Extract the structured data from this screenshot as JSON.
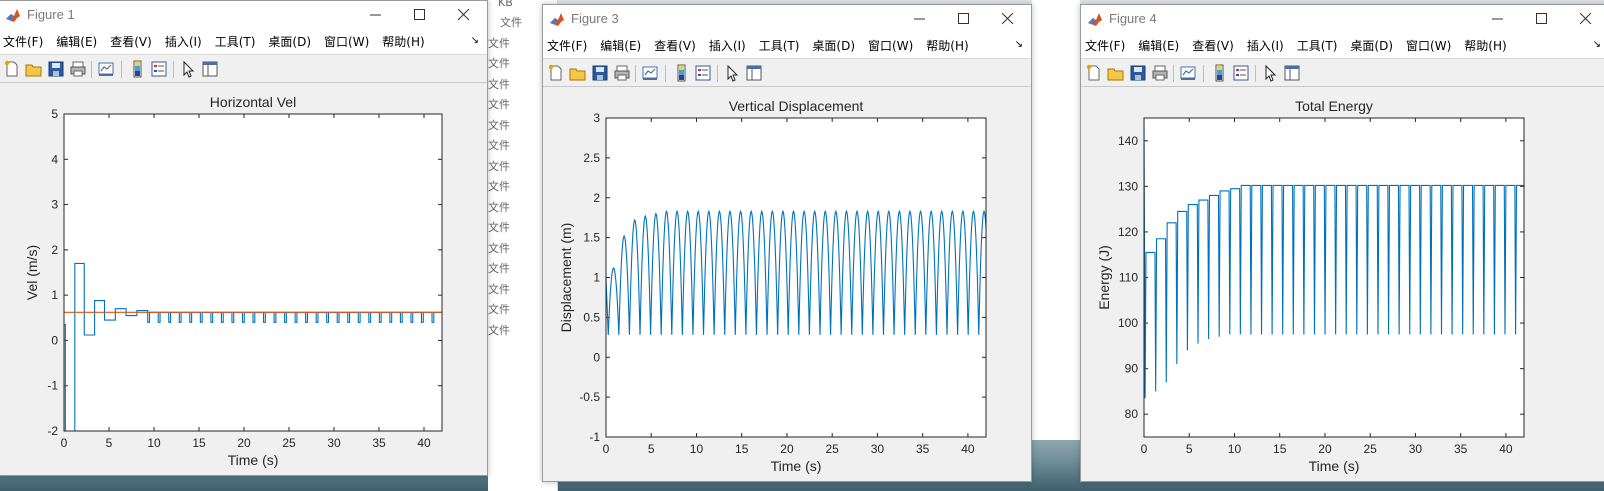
{
  "background_window": {
    "file_label": "文件",
    "top_text": "KB"
  },
  "menus": [
    "文件(F)",
    "编辑(E)",
    "查看(V)",
    "插入(I)",
    "工具(T)",
    "桌面(D)",
    "窗口(W)",
    "帮助(H)"
  ],
  "menu_overflow": "↘",
  "window_controls": {
    "minimize": "—",
    "maximize": "☐",
    "close": "✕"
  },
  "toolbar_icons": [
    "new-figure-icon",
    "open-file-icon",
    "save-icon",
    "print-icon",
    "link-plot-icon",
    "insert-colorbar-icon",
    "insert-legend-icon",
    "edit-plot-pointer-icon",
    "property-inspector-icon"
  ],
  "colors": {
    "line_blue": "#0072bd",
    "line_orange": "#d95319",
    "window_bg": "#f0f0f0"
  },
  "figures": [
    {
      "title": "Figure 1",
      "chart_data": {
        "type": "line",
        "title": "Horizontal Vel",
        "xlabel": "Time (s)",
        "ylabel": "Vel (m/s)",
        "xlim": [
          0,
          42
        ],
        "ylim": [
          -2,
          5
        ],
        "xticks": [
          0,
          5,
          10,
          15,
          20,
          25,
          30,
          35,
          40
        ],
        "yticks": [
          -2,
          -1,
          0,
          1,
          2,
          3,
          4,
          5
        ],
        "grid": false,
        "series": [
          {
            "color": "#0072bd",
            "values_desc": "step velocity: bounce dips to lower value each impact, peaks decay toward steady value",
            "flat_segments": [
              {
                "t0": 0.0,
                "t1": 0.15,
                "v": 0.35
              },
              {
                "t0": 0.3,
                "t1": 1.2,
                "v": -2.0
              },
              {
                "t0": 1.2,
                "t1": 2.25,
                "v": 1.7
              },
              {
                "t0": 2.25,
                "t1": 3.4,
                "v": 0.12
              },
              {
                "t0": 3.4,
                "t1": 4.5,
                "v": 0.88
              },
              {
                "t0": 4.5,
                "t1": 5.7,
                "v": 0.45
              },
              {
                "t0": 5.7,
                "t1": 6.9,
                "v": 0.7
              },
              {
                "t0": 6.9,
                "t1": 8.1,
                "v": 0.55
              },
              {
                "t0": 8.1,
                "t1": 9.3,
                "v": 0.66
              }
            ],
            "steady_value": 0.62,
            "dip_value": 0.4,
            "period": 1.17
          },
          {
            "color": "#d95319",
            "constant": 0.62
          }
        ]
      }
    },
    {
      "title": "Figure 3",
      "chart_data": {
        "type": "line",
        "title": "Vertical Displacement",
        "xlabel": "Time (s)",
        "ylabel": "Displacement (m)",
        "xlim": [
          0,
          42
        ],
        "ylim": [
          -1,
          3
        ],
        "xticks": [
          0,
          5,
          10,
          15,
          20,
          25,
          30,
          35,
          40
        ],
        "yticks": [
          -1,
          -0.5,
          0,
          0.5,
          1,
          1.5,
          2,
          2.5,
          3
        ],
        "grid": false,
        "series": [
          {
            "color": "#0072bd",
            "values_desc": "bouncing ball height, peaks grow from ~1.1 to ~1.83, minimum ~0.28",
            "min": 0.28,
            "peaks_first": [
              1.0,
              1.12,
              1.52,
              1.72,
              1.77,
              1.8
            ],
            "peak_steady": 1.83,
            "period": 1.17
          }
        ]
      }
    },
    {
      "title": "Figure 4",
      "chart_data": {
        "type": "line",
        "title": "Total Energy",
        "xlabel": "Time (s)",
        "ylabel": "Energy (J)",
        "xlim": [
          0,
          42
        ],
        "ylim": [
          75,
          145
        ],
        "xticks": [
          0,
          5,
          10,
          15,
          20,
          25,
          30,
          35,
          40
        ],
        "yticks": [
          80,
          90,
          100,
          110,
          120,
          130,
          140
        ],
        "grid": false,
        "series": [
          {
            "color": "#0072bd",
            "values_desc": "energy plateaus rising toward ~130 J with sharp downward spikes at each impact",
            "plateaus_first": [
              115.5,
              118.5,
              122,
              124.5,
              126,
              127,
              128,
              129,
              129.5
            ],
            "dips_first": [
              85,
              87,
              91,
              94,
              95.5,
              96.5,
              97
            ],
            "plateau_steady": 130.2,
            "dip_steady": 97.5,
            "initial_spike": 145,
            "period": 1.17
          }
        ]
      }
    }
  ]
}
